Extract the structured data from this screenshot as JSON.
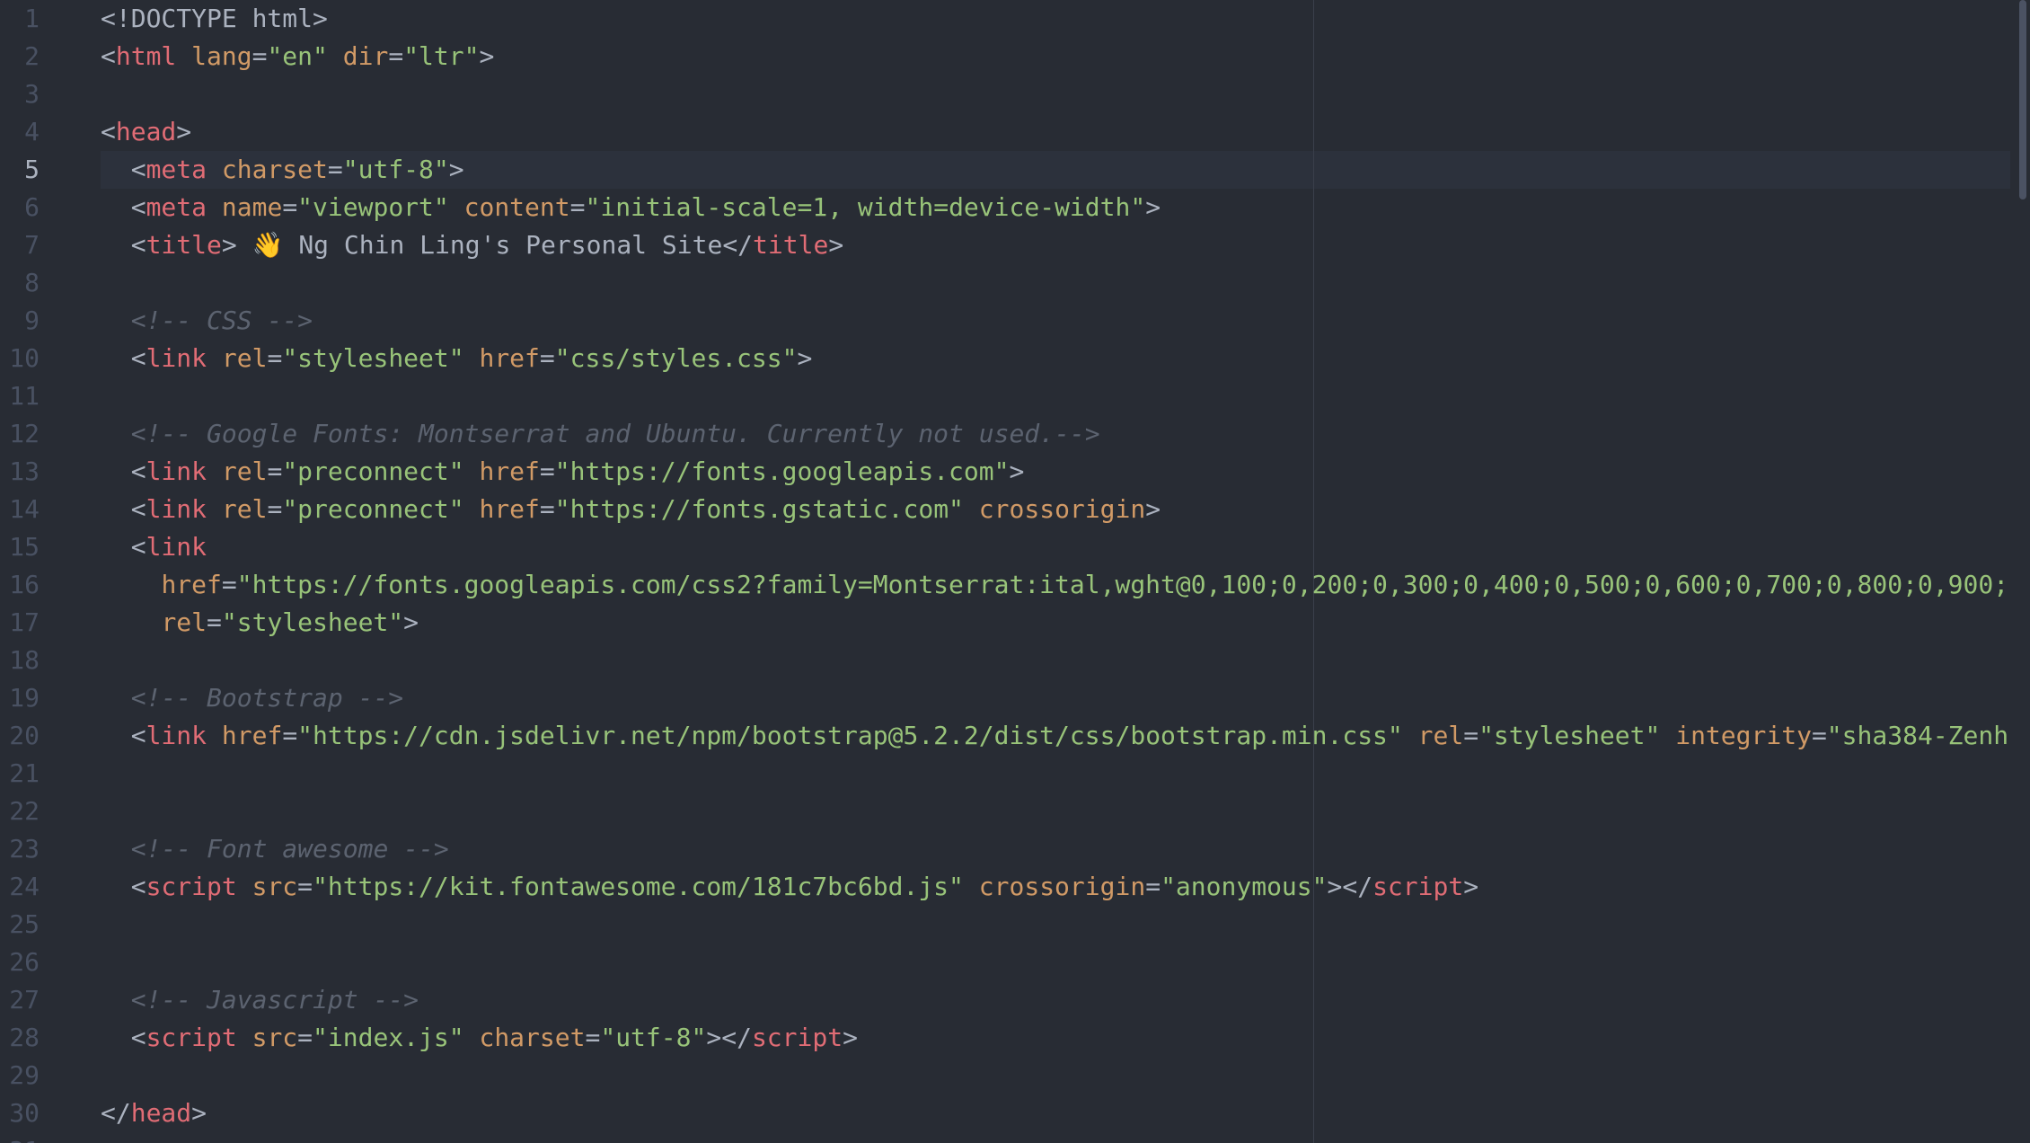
{
  "editor": {
    "active_line": 5,
    "colors": {
      "background": "#282c34",
      "line_highlight": "#2c313c",
      "gutter_text": "#495162",
      "gutter_active": "#abb2bf",
      "plain": "#abb2bf",
      "tag": "#e06c75",
      "attribute": "#d19a66",
      "string": "#98c379",
      "comment": "#5c6370"
    },
    "lines": [
      {
        "number": "1",
        "tokens": [
          [
            "punct",
            "<!DOCTYPE html>"
          ]
        ]
      },
      {
        "number": "2",
        "tokens": [
          [
            "punct",
            "<"
          ],
          [
            "tag",
            "html"
          ],
          [
            "text",
            " "
          ],
          [
            "attr",
            "lang"
          ],
          [
            "punct",
            "="
          ],
          [
            "str",
            "\"en\""
          ],
          [
            "text",
            " "
          ],
          [
            "attr",
            "dir"
          ],
          [
            "punct",
            "="
          ],
          [
            "str",
            "\"ltr\""
          ],
          [
            "punct",
            ">"
          ]
        ]
      },
      {
        "number": "3",
        "tokens": []
      },
      {
        "number": "4",
        "tokens": [
          [
            "punct",
            "<"
          ],
          [
            "tag",
            "head"
          ],
          [
            "punct",
            ">"
          ]
        ]
      },
      {
        "number": "5",
        "tokens": [
          [
            "text",
            "  "
          ],
          [
            "punct",
            "<"
          ],
          [
            "tag",
            "meta"
          ],
          [
            "text",
            " "
          ],
          [
            "attr",
            "charset"
          ],
          [
            "punct",
            "="
          ],
          [
            "str",
            "\"utf-8\""
          ],
          [
            "punct",
            ">"
          ]
        ]
      },
      {
        "number": "6",
        "tokens": [
          [
            "text",
            "  "
          ],
          [
            "punct",
            "<"
          ],
          [
            "tag",
            "meta"
          ],
          [
            "text",
            " "
          ],
          [
            "attr",
            "name"
          ],
          [
            "punct",
            "="
          ],
          [
            "str",
            "\"viewport\""
          ],
          [
            "text",
            " "
          ],
          [
            "attr",
            "content"
          ],
          [
            "punct",
            "="
          ],
          [
            "str",
            "\"initial-scale=1, width=device-width\""
          ],
          [
            "punct",
            ">"
          ]
        ]
      },
      {
        "number": "7",
        "tokens": [
          [
            "text",
            "  "
          ],
          [
            "punct",
            "<"
          ],
          [
            "tag",
            "title"
          ],
          [
            "punct",
            ">"
          ],
          [
            "text",
            " 👋 Ng Chin Ling's Personal Site"
          ],
          [
            "punct",
            "</"
          ],
          [
            "tag",
            "title"
          ],
          [
            "punct",
            ">"
          ]
        ]
      },
      {
        "number": "8",
        "tokens": []
      },
      {
        "number": "9",
        "tokens": [
          [
            "text",
            "  "
          ],
          [
            "comment",
            "<!-- CSS -->"
          ]
        ]
      },
      {
        "number": "10",
        "tokens": [
          [
            "text",
            "  "
          ],
          [
            "punct",
            "<"
          ],
          [
            "tag",
            "link"
          ],
          [
            "text",
            " "
          ],
          [
            "attr",
            "rel"
          ],
          [
            "punct",
            "="
          ],
          [
            "str",
            "\"stylesheet\""
          ],
          [
            "text",
            " "
          ],
          [
            "attr",
            "href"
          ],
          [
            "punct",
            "="
          ],
          [
            "str",
            "\"css/styles.css\""
          ],
          [
            "punct",
            ">"
          ]
        ]
      },
      {
        "number": "11",
        "tokens": []
      },
      {
        "number": "12",
        "tokens": [
          [
            "text",
            "  "
          ],
          [
            "comment",
            "<!-- Google Fonts: Montserrat and Ubuntu. Currently not used.-->"
          ]
        ]
      },
      {
        "number": "13",
        "tokens": [
          [
            "text",
            "  "
          ],
          [
            "punct",
            "<"
          ],
          [
            "tag",
            "link"
          ],
          [
            "text",
            " "
          ],
          [
            "attr",
            "rel"
          ],
          [
            "punct",
            "="
          ],
          [
            "str",
            "\"preconnect\""
          ],
          [
            "text",
            " "
          ],
          [
            "attr",
            "href"
          ],
          [
            "punct",
            "="
          ],
          [
            "str",
            "\"https://fonts.googleapis.com\""
          ],
          [
            "punct",
            ">"
          ]
        ]
      },
      {
        "number": "14",
        "tokens": [
          [
            "text",
            "  "
          ],
          [
            "punct",
            "<"
          ],
          [
            "tag",
            "link"
          ],
          [
            "text",
            " "
          ],
          [
            "attr",
            "rel"
          ],
          [
            "punct",
            "="
          ],
          [
            "str",
            "\"preconnect\""
          ],
          [
            "text",
            " "
          ],
          [
            "attr",
            "href"
          ],
          [
            "punct",
            "="
          ],
          [
            "str",
            "\"https://fonts.gstatic.com\""
          ],
          [
            "text",
            " "
          ],
          [
            "attr",
            "crossorigin"
          ],
          [
            "punct",
            ">"
          ]
        ]
      },
      {
        "number": "15",
        "tokens": [
          [
            "text",
            "  "
          ],
          [
            "punct",
            "<"
          ],
          [
            "tag",
            "link"
          ]
        ]
      },
      {
        "number": "16",
        "tokens": [
          [
            "text",
            "    "
          ],
          [
            "attr",
            "href"
          ],
          [
            "punct",
            "="
          ],
          [
            "str",
            "\"https://fonts.googleapis.com/css2?family=Montserrat:ital,wght@0,100;0,200;0,300;0,400;0,500;0,600;0,700;0,800;0,900;"
          ]
        ]
      },
      {
        "number": "17",
        "tokens": [
          [
            "text",
            "    "
          ],
          [
            "attr",
            "rel"
          ],
          [
            "punct",
            "="
          ],
          [
            "str",
            "\"stylesheet\""
          ],
          [
            "punct",
            ">"
          ]
        ]
      },
      {
        "number": "18",
        "tokens": []
      },
      {
        "number": "19",
        "tokens": [
          [
            "text",
            "  "
          ],
          [
            "comment",
            "<!-- Bootstrap -->"
          ]
        ]
      },
      {
        "number": "20",
        "tokens": [
          [
            "text",
            "  "
          ],
          [
            "punct",
            "<"
          ],
          [
            "tag",
            "link"
          ],
          [
            "text",
            " "
          ],
          [
            "attr",
            "href"
          ],
          [
            "punct",
            "="
          ],
          [
            "str",
            "\"https://cdn.jsdelivr.net/npm/bootstrap@5.2.2/dist/css/bootstrap.min.css\""
          ],
          [
            "text",
            " "
          ],
          [
            "attr",
            "rel"
          ],
          [
            "punct",
            "="
          ],
          [
            "str",
            "\"stylesheet\""
          ],
          [
            "text",
            " "
          ],
          [
            "attr",
            "integrity"
          ],
          [
            "punct",
            "="
          ],
          [
            "str",
            "\"sha384-Zenh"
          ]
        ]
      },
      {
        "number": "21",
        "tokens": []
      },
      {
        "number": "22",
        "tokens": []
      },
      {
        "number": "23",
        "tokens": [
          [
            "text",
            "  "
          ],
          [
            "comment",
            "<!-- Font awesome -->"
          ]
        ]
      },
      {
        "number": "24",
        "tokens": [
          [
            "text",
            "  "
          ],
          [
            "punct",
            "<"
          ],
          [
            "tag",
            "script"
          ],
          [
            "text",
            " "
          ],
          [
            "attr",
            "src"
          ],
          [
            "punct",
            "="
          ],
          [
            "str",
            "\"https://kit.fontawesome.com/181c7bc6bd.js\""
          ],
          [
            "text",
            " "
          ],
          [
            "attr",
            "crossorigin"
          ],
          [
            "punct",
            "="
          ],
          [
            "str",
            "\"anonymous\""
          ],
          [
            "punct",
            "></"
          ],
          [
            "tag",
            "script"
          ],
          [
            "punct",
            ">"
          ]
        ]
      },
      {
        "number": "25",
        "tokens": []
      },
      {
        "number": "26",
        "tokens": []
      },
      {
        "number": "27",
        "tokens": [
          [
            "text",
            "  "
          ],
          [
            "comment",
            "<!-- Javascript -->"
          ]
        ]
      },
      {
        "number": "28",
        "tokens": [
          [
            "text",
            "  "
          ],
          [
            "punct",
            "<"
          ],
          [
            "tag",
            "script"
          ],
          [
            "text",
            " "
          ],
          [
            "attr",
            "src"
          ],
          [
            "punct",
            "="
          ],
          [
            "str",
            "\"index.js\""
          ],
          [
            "text",
            " "
          ],
          [
            "attr",
            "charset"
          ],
          [
            "punct",
            "="
          ],
          [
            "str",
            "\"utf-8\""
          ],
          [
            "punct",
            "></"
          ],
          [
            "tag",
            "script"
          ],
          [
            "punct",
            ">"
          ]
        ]
      },
      {
        "number": "29",
        "tokens": []
      },
      {
        "number": "30",
        "tokens": [
          [
            "punct",
            "</"
          ],
          [
            "tag",
            "head"
          ],
          [
            "punct",
            ">"
          ]
        ]
      },
      {
        "number": "31",
        "tokens": []
      }
    ]
  }
}
